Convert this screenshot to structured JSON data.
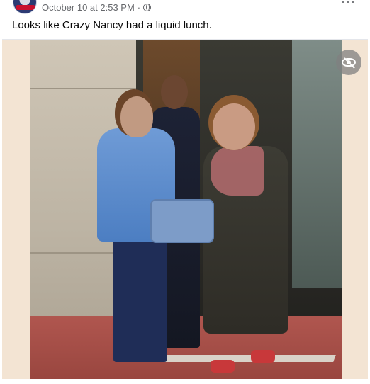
{
  "post": {
    "timestamp": "October 10 at 2:53 PM",
    "separator": "·",
    "privacy_icon": "globe-icon",
    "more_icon": "ellipsis-icon",
    "more_label": "···",
    "caption": "Looks like Crazy Nancy had a liquid lunch."
  },
  "media": {
    "overlay_icon": "eye-slash-icon"
  }
}
